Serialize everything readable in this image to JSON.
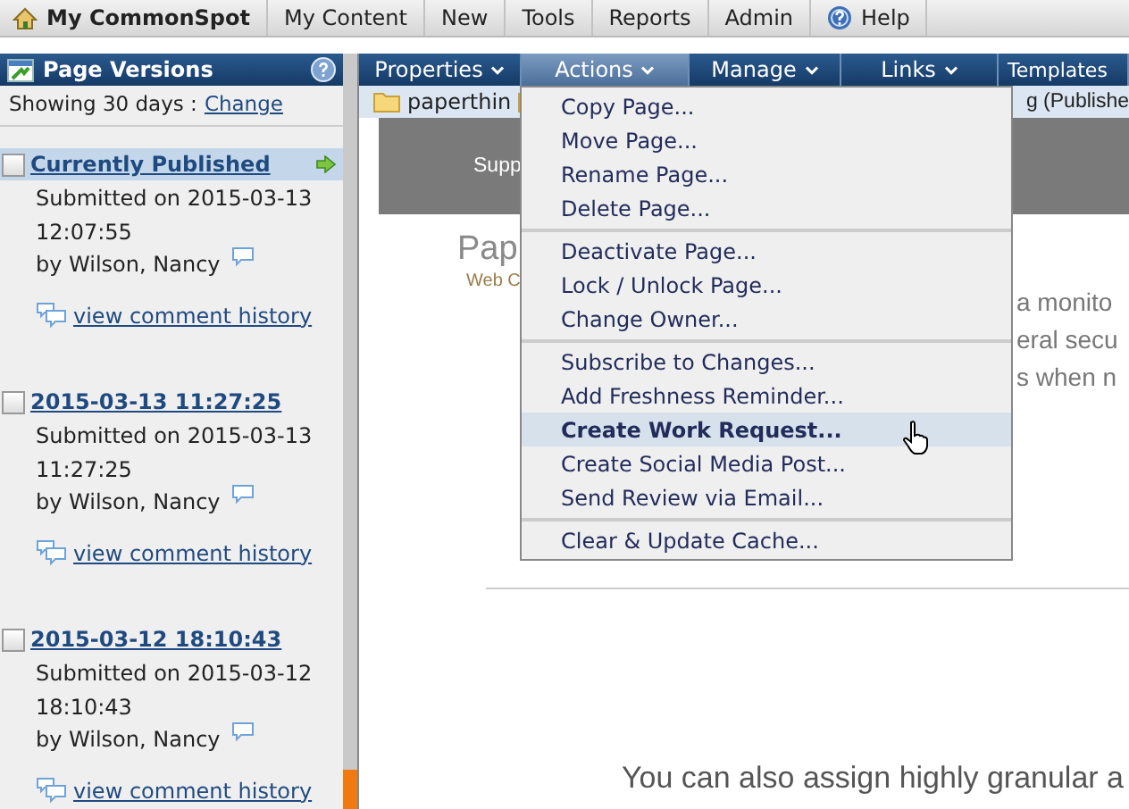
{
  "top_nav": {
    "brand": "My CommonSpot",
    "items": [
      {
        "label": "My Content",
        "kind": "text"
      },
      {
        "label": "New",
        "kind": "text"
      },
      {
        "label": "Tools",
        "kind": "text"
      },
      {
        "label": "Reports",
        "kind": "text"
      },
      {
        "label": "Admin",
        "kind": "text"
      },
      {
        "label": "Help",
        "kind": "help"
      }
    ]
  },
  "sidebar": {
    "title": "Page Versions",
    "showing": "Showing 30 days :",
    "change_link": "Change",
    "versions": [
      {
        "title": "Currently Published",
        "selected": true,
        "submitted": "Submitted on 2015-03-13 12:07:55",
        "by": "by Wilson, Nancy",
        "history_link": "view comment history"
      },
      {
        "title": "2015-03-13 11:27:25",
        "selected": false,
        "submitted": "Submitted on 2015-03-13 11:27:25",
        "by": "by Wilson, Nancy",
        "history_link": "view comment history"
      },
      {
        "title": "2015-03-12 18:10:43",
        "selected": false,
        "submitted": "Submitted on 2015-03-12 18:10:43",
        "by": "by Wilson, Nancy",
        "history_link": "view comment history"
      }
    ]
  },
  "menu_tabs": [
    {
      "label": "Properties",
      "selected": false
    },
    {
      "label": "Actions",
      "selected": true
    },
    {
      "label": "Manage",
      "selected": false
    },
    {
      "label": "Links",
      "selected": false
    },
    {
      "label": "Templates",
      "selected": false
    }
  ],
  "breadcrumb": {
    "folder": "paperthin",
    "page": "g (Publishe"
  },
  "page_preview": {
    "banner": "Supp",
    "heading": "Pap",
    "subheading": "Web C",
    "lines": [
      "a monito",
      "eral secu",
      "s when n"
    ],
    "footer_text": "You can also assign highly granular a"
  },
  "actions_menu": {
    "groups": [
      {
        "items": [
          {
            "label": "Copy Page...",
            "highlighted": false
          },
          {
            "label": "Move Page...",
            "highlighted": false
          },
          {
            "label": "Rename Page...",
            "highlighted": false
          },
          {
            "label": "Delete Page...",
            "highlighted": false
          }
        ]
      },
      {
        "items": [
          {
            "label": "Deactivate Page...",
            "highlighted": false
          },
          {
            "label": "Lock / Unlock Page...",
            "highlighted": false
          },
          {
            "label": "Change Owner...",
            "highlighted": false
          }
        ]
      },
      {
        "items": [
          {
            "label": "Subscribe to Changes...",
            "highlighted": false
          },
          {
            "label": "Add Freshness Reminder...",
            "highlighted": false
          },
          {
            "label": "Create Work Request...",
            "highlighted": true
          },
          {
            "label": "Create Social Media Post...",
            "highlighted": false
          },
          {
            "label": "Send Review via Email...",
            "highlighted": false
          }
        ]
      },
      {
        "items": [
          {
            "label": "Clear & Update Cache...",
            "highlighted": false
          }
        ]
      }
    ]
  }
}
